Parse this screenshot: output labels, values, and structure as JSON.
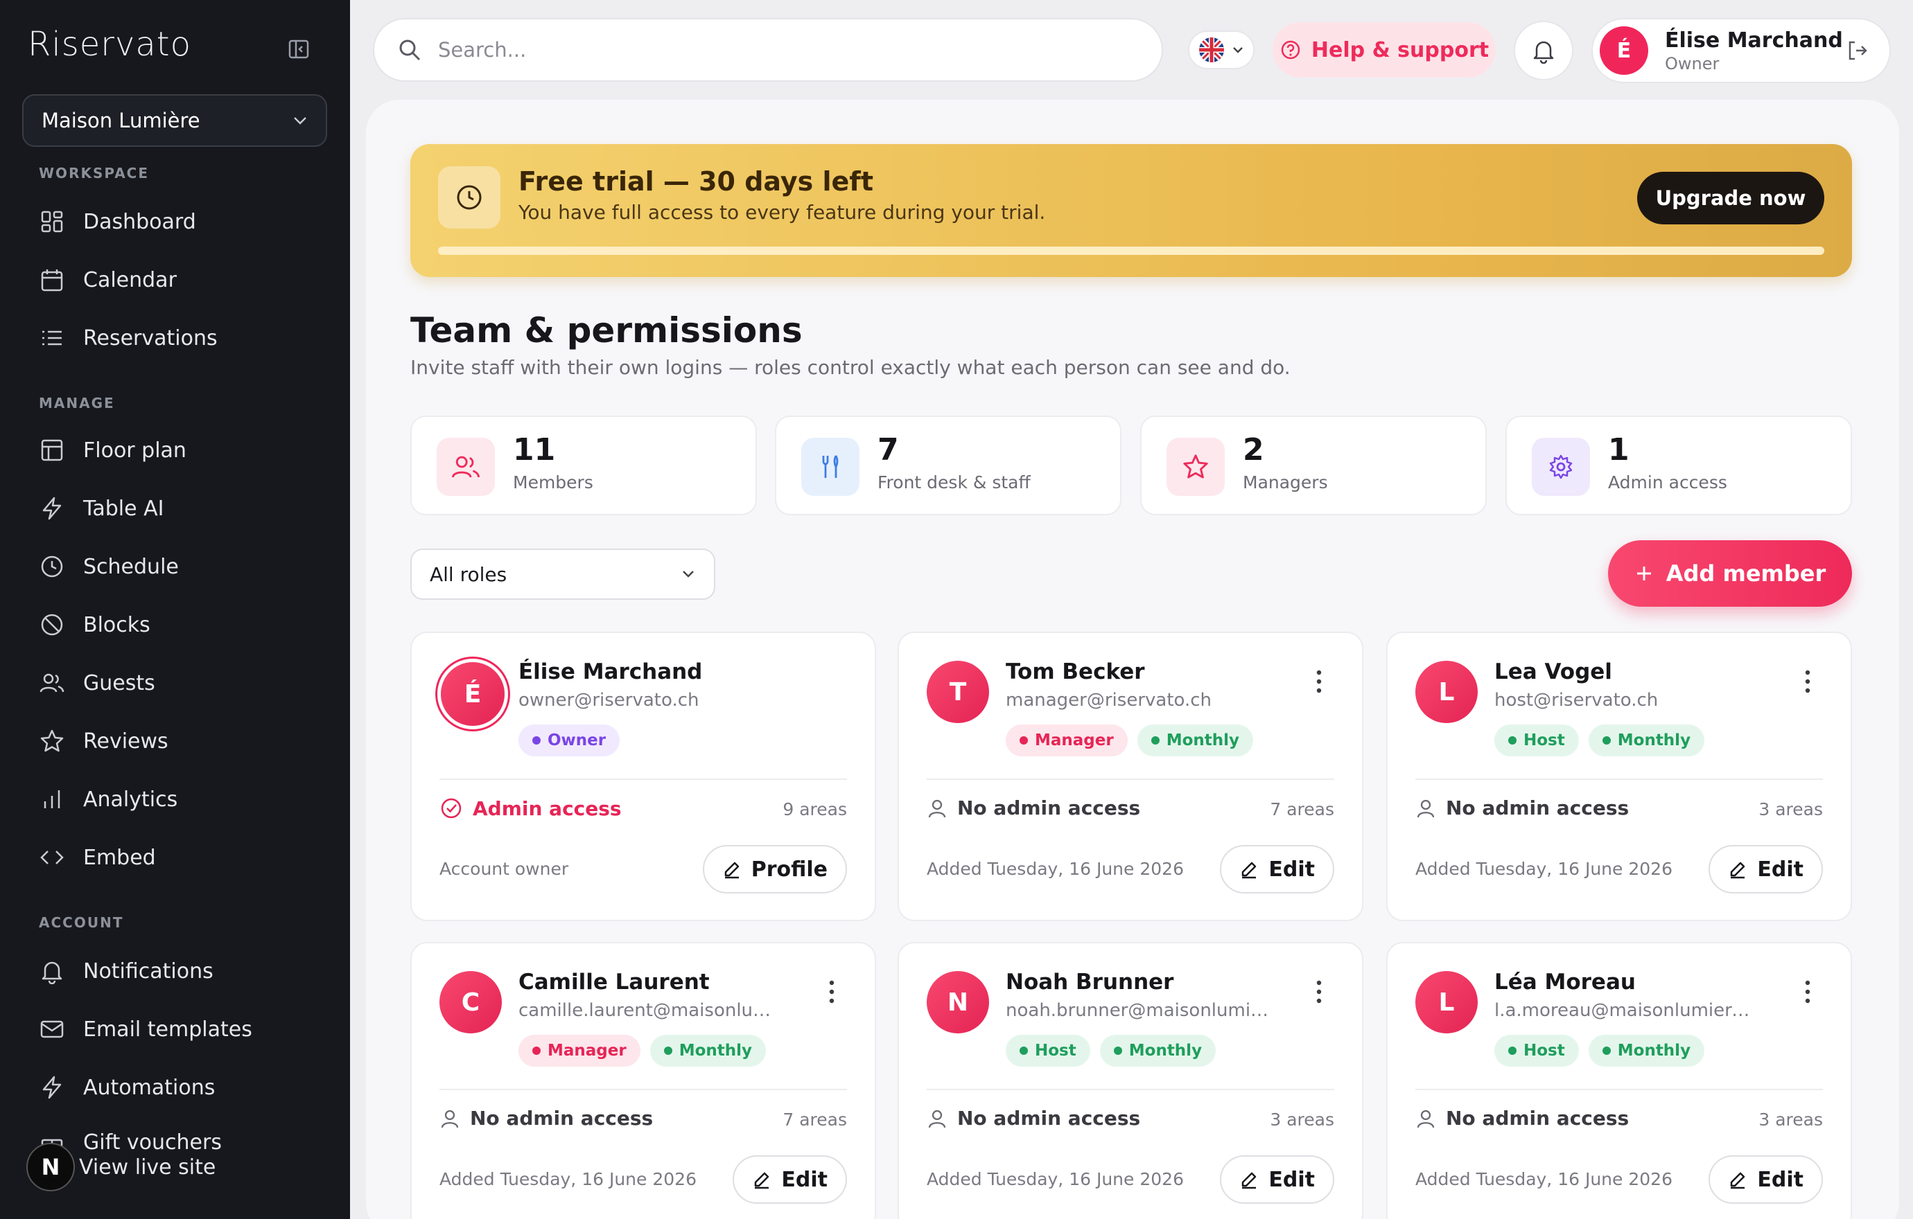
{
  "app": {
    "brand": "Riservato"
  },
  "sidebar": {
    "venue": "Maison Lumière",
    "sections": {
      "workspace": "WORKSPACE",
      "manage": "MANAGE",
      "account": "ACCOUNT"
    },
    "workspace_items": [
      {
        "label": "Dashboard",
        "icon": "dashboard-icon"
      },
      {
        "label": "Calendar",
        "icon": "calendar-icon"
      },
      {
        "label": "Reservations",
        "icon": "list-icon"
      }
    ],
    "manage_items": [
      {
        "label": "Floor plan",
        "icon": "floor-plan-icon"
      },
      {
        "label": "Table AI",
        "icon": "lightning-icon"
      },
      {
        "label": "Schedule",
        "icon": "clock-icon"
      },
      {
        "label": "Blocks",
        "icon": "block-icon"
      },
      {
        "label": "Guests",
        "icon": "users-icon"
      },
      {
        "label": "Reviews",
        "icon": "star-icon"
      },
      {
        "label": "Analytics",
        "icon": "bar-chart-icon"
      },
      {
        "label": "Embed",
        "icon": "code-icon"
      }
    ],
    "account_items": [
      {
        "label": "Notifications",
        "icon": "bell-icon"
      },
      {
        "label": "Email templates",
        "icon": "mail-icon"
      },
      {
        "label": "Automations",
        "icon": "lightning-icon"
      },
      {
        "label": "Gift vouchers",
        "icon": "gift-icon"
      }
    ],
    "view_live_site": "View live site",
    "live_badge": "N"
  },
  "topbar": {
    "search_placeholder": "Search...",
    "help_label": "Help & support",
    "user": {
      "name": "Élise Marchand",
      "role": "Owner",
      "initial": "É"
    }
  },
  "trial": {
    "title": "Free trial — 30 days left",
    "subtitle": "You have full access to every feature during your trial.",
    "cta": "Upgrade now",
    "progress": 1.0
  },
  "page": {
    "title": "Team & permissions",
    "subtitle": "Invite staff with their own logins — roles control exactly what each person can see and do."
  },
  "stats": [
    {
      "value": "11",
      "label": "Members",
      "icon": "users-icon",
      "bg": "#fde8ee",
      "color": "#ee2b5b"
    },
    {
      "value": "7",
      "label": "Front desk & staff",
      "icon": "cutlery-icon",
      "bg": "#e6f0fd",
      "color": "#3d7de4"
    },
    {
      "value": "2",
      "label": "Managers",
      "icon": "star-icon",
      "bg": "#fde8ee",
      "color": "#ee2b5b"
    },
    {
      "value": "1",
      "label": "Admin access",
      "icon": "gear-icon",
      "bg": "#efe9fd",
      "color": "#7a45e6"
    }
  ],
  "filter": {
    "value": "All roles"
  },
  "add_member_label": "Add member",
  "members": [
    {
      "initial": "É",
      "name": "Élise Marchand",
      "email": "owner@riservato.ch",
      "badges": [
        {
          "label": "Owner",
          "kind": "owner"
        }
      ],
      "admin": true,
      "access": "Admin access",
      "areas": "9 areas",
      "footer": "Account owner",
      "button": "Profile"
    },
    {
      "initial": "T",
      "name": "Tom Becker",
      "email": "manager@riservato.ch",
      "badges": [
        {
          "label": "Manager",
          "kind": "manager"
        },
        {
          "label": "Monthly",
          "kind": "monthly"
        }
      ],
      "admin": false,
      "access": "No admin access",
      "areas": "7 areas",
      "footer": "Added Tuesday, 16 June 2026",
      "button": "Edit"
    },
    {
      "initial": "L",
      "name": "Lea Vogel",
      "email": "host@riservato.ch",
      "badges": [
        {
          "label": "Host",
          "kind": "host"
        },
        {
          "label": "Monthly",
          "kind": "monthly"
        }
      ],
      "admin": false,
      "access": "No admin access",
      "areas": "3 areas",
      "footer": "Added Tuesday, 16 June 2026",
      "button": "Edit"
    },
    {
      "initial": "C",
      "name": "Camille Laurent",
      "email": "camille.laurent@maisonlumi...",
      "badges": [
        {
          "label": "Manager",
          "kind": "manager"
        },
        {
          "label": "Monthly",
          "kind": "monthly"
        }
      ],
      "admin": false,
      "access": "No admin access",
      "areas": "7 areas",
      "footer": "Added Tuesday, 16 June 2026",
      "button": "Edit"
    },
    {
      "initial": "N",
      "name": "Noah Brunner",
      "email": "noah.brunner@maisonlumier...",
      "badges": [
        {
          "label": "Host",
          "kind": "host"
        },
        {
          "label": "Monthly",
          "kind": "monthly"
        }
      ],
      "admin": false,
      "access": "No admin access",
      "areas": "3 areas",
      "footer": "Added Tuesday, 16 June 2026",
      "button": "Edit"
    },
    {
      "initial": "L",
      "name": "Léa Moreau",
      "email": "l.a.moreau@maisonlumiere.ch",
      "badges": [
        {
          "label": "Host",
          "kind": "host"
        },
        {
          "label": "Monthly",
          "kind": "monthly"
        }
      ],
      "admin": false,
      "access": "No admin access",
      "areas": "3 areas",
      "footer": "Added Tuesday, 16 June 2026",
      "button": "Edit"
    }
  ]
}
